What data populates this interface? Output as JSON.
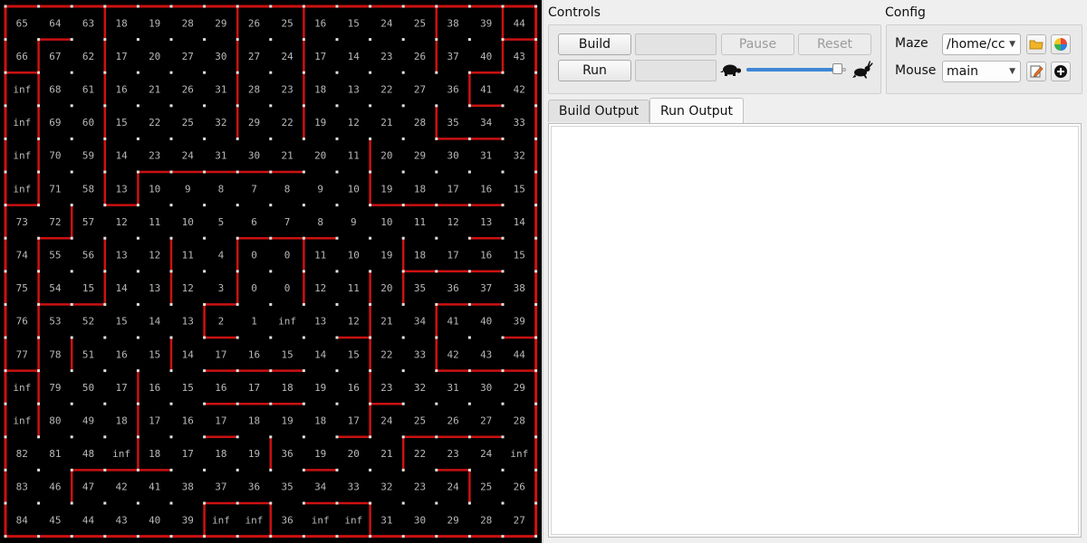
{
  "maze": {
    "colors": {
      "background": "#000000",
      "wall": "#cc1111",
      "post": "#e0e0e0",
      "text": "#b8b8b8"
    },
    "distances": [
      [
        "65",
        "64",
        "63",
        "18",
        "19",
        "28",
        "29",
        "26",
        "25",
        "16",
        "15",
        "24",
        "25",
        "38",
        "39",
        "44"
      ],
      [
        "66",
        "67",
        "62",
        "17",
        "20",
        "27",
        "30",
        "27",
        "24",
        "17",
        "14",
        "23",
        "26",
        "37",
        "40",
        "43"
      ],
      [
        "inf",
        "68",
        "61",
        "16",
        "21",
        "26",
        "31",
        "28",
        "23",
        "18",
        "13",
        "22",
        "27",
        "36",
        "41",
        "42"
      ],
      [
        "inf",
        "69",
        "60",
        "15",
        "22",
        "25",
        "32",
        "29",
        "22",
        "19",
        "12",
        "21",
        "28",
        "35",
        "34",
        "33"
      ],
      [
        "inf",
        "70",
        "59",
        "14",
        "23",
        "24",
        "31",
        "30",
        "21",
        "20",
        "11",
        "20",
        "29",
        "30",
        "31",
        "32"
      ],
      [
        "inf",
        "71",
        "58",
        "13",
        "10",
        "9",
        "8",
        "7",
        "8",
        "9",
        "10",
        "19",
        "18",
        "17",
        "16",
        "15"
      ],
      [
        "73",
        "72",
        "57",
        "12",
        "11",
        "10",
        "5",
        "6",
        "7",
        "8",
        "9",
        "10",
        "11",
        "12",
        "13",
        "14"
      ],
      [
        "74",
        "55",
        "56",
        "13",
        "12",
        "11",
        "4",
        "0",
        "0",
        "11",
        "10",
        "19",
        "18",
        "17",
        "16",
        "15"
      ],
      [
        "75",
        "54",
        "15",
        "14",
        "13",
        "12",
        "3",
        "0",
        "0",
        "12",
        "11",
        "20",
        "35",
        "36",
        "37",
        "38"
      ],
      [
        "76",
        "53",
        "52",
        "15",
        "14",
        "13",
        "2",
        "1",
        "inf",
        "13",
        "12",
        "21",
        "34",
        "41",
        "40",
        "39"
      ],
      [
        "77",
        "78",
        "51",
        "16",
        "15",
        "14",
        "17",
        "16",
        "15",
        "14",
        "15",
        "22",
        "33",
        "42",
        "43",
        "44"
      ],
      [
        "inf",
        "79",
        "50",
        "17",
        "16",
        "15",
        "16",
        "17",
        "18",
        "19",
        "16",
        "23",
        "32",
        "31",
        "30",
        "29"
      ],
      [
        "inf",
        "80",
        "49",
        "18",
        "17",
        "16",
        "17",
        "18",
        "19",
        "18",
        "17",
        "24",
        "25",
        "26",
        "27",
        "28"
      ],
      [
        "82",
        "81",
        "48",
        "inf",
        "18",
        "17",
        "18",
        "19",
        "36",
        "19",
        "20",
        "21",
        "22",
        "23",
        "24",
        "inf"
      ],
      [
        "83",
        "46",
        "47",
        "42",
        "41",
        "38",
        "37",
        "36",
        "35",
        "34",
        "33",
        "32",
        "23",
        "24",
        "25",
        "26"
      ],
      [
        "84",
        "45",
        "44",
        "43",
        "40",
        "39",
        "inf",
        "inf",
        "36",
        "inf",
        "inf",
        "31",
        "30",
        "29",
        "28",
        "27"
      ]
    ],
    "walls": {
      "horizontal": [
        [
          1,
          1
        ],
        [
          1,
          15
        ],
        [
          2,
          0
        ],
        [
          2,
          14
        ],
        [
          3,
          14
        ],
        [
          4,
          13
        ],
        [
          4,
          14
        ],
        [
          5,
          4
        ],
        [
          5,
          5
        ],
        [
          5,
          6
        ],
        [
          5,
          7
        ],
        [
          5,
          8
        ],
        [
          6,
          0
        ],
        [
          6,
          3
        ],
        [
          6,
          11
        ],
        [
          6,
          12
        ],
        [
          6,
          13
        ],
        [
          6,
          14
        ],
        [
          7,
          1
        ],
        [
          7,
          7
        ],
        [
          7,
          8
        ],
        [
          7,
          9
        ],
        [
          7,
          14
        ],
        [
          8,
          12
        ],
        [
          8,
          13
        ],
        [
          8,
          14
        ],
        [
          9,
          1
        ],
        [
          9,
          2
        ],
        [
          9,
          6
        ],
        [
          9,
          13
        ],
        [
          9,
          14
        ],
        [
          10,
          6
        ],
        [
          10,
          10
        ],
        [
          10,
          15
        ],
        [
          11,
          0
        ],
        [
          11,
          6
        ],
        [
          11,
          7
        ],
        [
          11,
          8
        ],
        [
          11,
          13
        ],
        [
          11,
          14
        ],
        [
          11,
          15
        ],
        [
          12,
          6
        ],
        [
          12,
          7
        ],
        [
          12,
          8
        ],
        [
          12,
          11
        ],
        [
          13,
          6
        ],
        [
          13,
          10
        ],
        [
          13,
          12
        ],
        [
          13,
          13
        ],
        [
          13,
          14
        ],
        [
          14,
          2
        ],
        [
          14,
          3
        ],
        [
          14,
          4
        ],
        [
          14,
          9
        ],
        [
          14,
          13
        ],
        [
          15,
          6
        ],
        [
          15,
          7
        ],
        [
          15,
          9
        ],
        [
          15,
          10
        ]
      ],
      "vertical": [
        [
          0,
          3
        ],
        [
          0,
          7
        ],
        [
          0,
          9
        ],
        [
          0,
          13
        ],
        [
          0,
          15
        ],
        [
          1,
          1
        ],
        [
          1,
          3
        ],
        [
          1,
          7
        ],
        [
          1,
          9
        ],
        [
          1,
          13
        ],
        [
          1,
          15
        ],
        [
          2,
          1
        ],
        [
          2,
          3
        ],
        [
          2,
          7
        ],
        [
          2,
          9
        ],
        [
          2,
          14
        ],
        [
          3,
          1
        ],
        [
          3,
          3
        ],
        [
          3,
          7
        ],
        [
          3,
          9
        ],
        [
          3,
          13
        ],
        [
          4,
          1
        ],
        [
          4,
          3
        ],
        [
          4,
          11
        ],
        [
          5,
          1
        ],
        [
          5,
          3
        ],
        [
          5,
          4
        ],
        [
          5,
          11
        ],
        [
          6,
          2
        ],
        [
          7,
          1
        ],
        [
          7,
          3
        ],
        [
          7,
          5
        ],
        [
          7,
          7
        ],
        [
          7,
          9
        ],
        [
          7,
          12
        ],
        [
          8,
          1
        ],
        [
          8,
          3
        ],
        [
          8,
          5
        ],
        [
          8,
          7
        ],
        [
          8,
          9
        ],
        [
          8,
          11
        ],
        [
          8,
          12
        ],
        [
          9,
          1
        ],
        [
          9,
          6
        ],
        [
          9,
          11
        ],
        [
          9,
          13
        ],
        [
          10,
          1
        ],
        [
          10,
          2
        ],
        [
          10,
          5
        ],
        [
          10,
          11
        ],
        [
          10,
          13
        ],
        [
          11,
          1
        ],
        [
          11,
          4
        ],
        [
          11,
          11
        ],
        [
          12,
          1
        ],
        [
          12,
          4
        ],
        [
          12,
          11
        ],
        [
          13,
          4
        ],
        [
          13,
          8
        ],
        [
          13,
          12
        ],
        [
          14,
          2
        ],
        [
          14,
          14
        ],
        [
          15,
          6
        ],
        [
          15,
          8
        ],
        [
          15,
          11
        ]
      ]
    }
  },
  "controls": {
    "title": "Controls",
    "build_label": "Build",
    "run_label": "Run",
    "pause_label": "Pause",
    "reset_label": "Reset",
    "speed_fraction": 0.96,
    "slow_icon": "turtle-icon",
    "fast_icon": "rabbit-icon"
  },
  "config": {
    "title": "Config",
    "maze_label": "Maze",
    "maze_value": "/home/cc",
    "mouse_label": "Mouse",
    "mouse_value": "main"
  },
  "tabs": [
    {
      "label": "Build Output",
      "active": false
    },
    {
      "label": "Run Output",
      "active": true
    }
  ]
}
